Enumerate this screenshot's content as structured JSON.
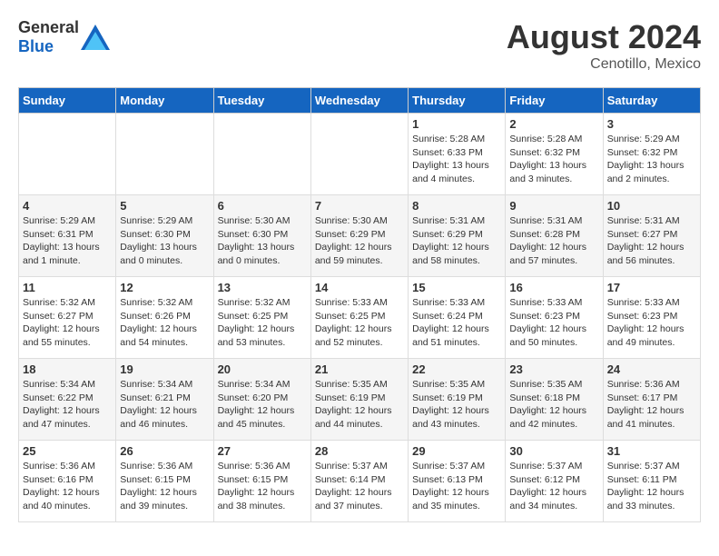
{
  "header": {
    "logo_general": "General",
    "logo_blue": "Blue",
    "month_year": "August 2024",
    "location": "Cenotillo, Mexico"
  },
  "days_of_week": [
    "Sunday",
    "Monday",
    "Tuesday",
    "Wednesday",
    "Thursday",
    "Friday",
    "Saturday"
  ],
  "weeks": [
    [
      {
        "day": "",
        "info": ""
      },
      {
        "day": "",
        "info": ""
      },
      {
        "day": "",
        "info": ""
      },
      {
        "day": "",
        "info": ""
      },
      {
        "day": "1",
        "info": "Sunrise: 5:28 AM\nSunset: 6:33 PM\nDaylight: 13 hours\nand 4 minutes."
      },
      {
        "day": "2",
        "info": "Sunrise: 5:28 AM\nSunset: 6:32 PM\nDaylight: 13 hours\nand 3 minutes."
      },
      {
        "day": "3",
        "info": "Sunrise: 5:29 AM\nSunset: 6:32 PM\nDaylight: 13 hours\nand 2 minutes."
      }
    ],
    [
      {
        "day": "4",
        "info": "Sunrise: 5:29 AM\nSunset: 6:31 PM\nDaylight: 13 hours\nand 1 minute."
      },
      {
        "day": "5",
        "info": "Sunrise: 5:29 AM\nSunset: 6:30 PM\nDaylight: 13 hours\nand 0 minutes."
      },
      {
        "day": "6",
        "info": "Sunrise: 5:30 AM\nSunset: 6:30 PM\nDaylight: 13 hours\nand 0 minutes."
      },
      {
        "day": "7",
        "info": "Sunrise: 5:30 AM\nSunset: 6:29 PM\nDaylight: 12 hours\nand 59 minutes."
      },
      {
        "day": "8",
        "info": "Sunrise: 5:31 AM\nSunset: 6:29 PM\nDaylight: 12 hours\nand 58 minutes."
      },
      {
        "day": "9",
        "info": "Sunrise: 5:31 AM\nSunset: 6:28 PM\nDaylight: 12 hours\nand 57 minutes."
      },
      {
        "day": "10",
        "info": "Sunrise: 5:31 AM\nSunset: 6:27 PM\nDaylight: 12 hours\nand 56 minutes."
      }
    ],
    [
      {
        "day": "11",
        "info": "Sunrise: 5:32 AM\nSunset: 6:27 PM\nDaylight: 12 hours\nand 55 minutes."
      },
      {
        "day": "12",
        "info": "Sunrise: 5:32 AM\nSunset: 6:26 PM\nDaylight: 12 hours\nand 54 minutes."
      },
      {
        "day": "13",
        "info": "Sunrise: 5:32 AM\nSunset: 6:25 PM\nDaylight: 12 hours\nand 53 minutes."
      },
      {
        "day": "14",
        "info": "Sunrise: 5:33 AM\nSunset: 6:25 PM\nDaylight: 12 hours\nand 52 minutes."
      },
      {
        "day": "15",
        "info": "Sunrise: 5:33 AM\nSunset: 6:24 PM\nDaylight: 12 hours\nand 51 minutes."
      },
      {
        "day": "16",
        "info": "Sunrise: 5:33 AM\nSunset: 6:23 PM\nDaylight: 12 hours\nand 50 minutes."
      },
      {
        "day": "17",
        "info": "Sunrise: 5:33 AM\nSunset: 6:23 PM\nDaylight: 12 hours\nand 49 minutes."
      }
    ],
    [
      {
        "day": "18",
        "info": "Sunrise: 5:34 AM\nSunset: 6:22 PM\nDaylight: 12 hours\nand 47 minutes."
      },
      {
        "day": "19",
        "info": "Sunrise: 5:34 AM\nSunset: 6:21 PM\nDaylight: 12 hours\nand 46 minutes."
      },
      {
        "day": "20",
        "info": "Sunrise: 5:34 AM\nSunset: 6:20 PM\nDaylight: 12 hours\nand 45 minutes."
      },
      {
        "day": "21",
        "info": "Sunrise: 5:35 AM\nSunset: 6:19 PM\nDaylight: 12 hours\nand 44 minutes."
      },
      {
        "day": "22",
        "info": "Sunrise: 5:35 AM\nSunset: 6:19 PM\nDaylight: 12 hours\nand 43 minutes."
      },
      {
        "day": "23",
        "info": "Sunrise: 5:35 AM\nSunset: 6:18 PM\nDaylight: 12 hours\nand 42 minutes."
      },
      {
        "day": "24",
        "info": "Sunrise: 5:36 AM\nSunset: 6:17 PM\nDaylight: 12 hours\nand 41 minutes."
      }
    ],
    [
      {
        "day": "25",
        "info": "Sunrise: 5:36 AM\nSunset: 6:16 PM\nDaylight: 12 hours\nand 40 minutes."
      },
      {
        "day": "26",
        "info": "Sunrise: 5:36 AM\nSunset: 6:15 PM\nDaylight: 12 hours\nand 39 minutes."
      },
      {
        "day": "27",
        "info": "Sunrise: 5:36 AM\nSunset: 6:15 PM\nDaylight: 12 hours\nand 38 minutes."
      },
      {
        "day": "28",
        "info": "Sunrise: 5:37 AM\nSunset: 6:14 PM\nDaylight: 12 hours\nand 37 minutes."
      },
      {
        "day": "29",
        "info": "Sunrise: 5:37 AM\nSunset: 6:13 PM\nDaylight: 12 hours\nand 35 minutes."
      },
      {
        "day": "30",
        "info": "Sunrise: 5:37 AM\nSunset: 6:12 PM\nDaylight: 12 hours\nand 34 minutes."
      },
      {
        "day": "31",
        "info": "Sunrise: 5:37 AM\nSunset: 6:11 PM\nDaylight: 12 hours\nand 33 minutes."
      }
    ]
  ]
}
